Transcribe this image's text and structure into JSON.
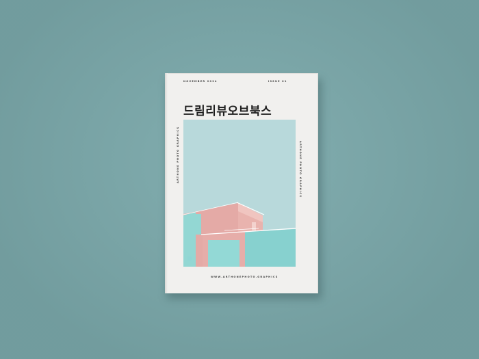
{
  "cover": {
    "date": "NOVEMBER 2024",
    "issue": "ISSUE 01",
    "title": "드림리뷰오브북스",
    "side_text_left": "ARTHONE PHOTO GRAPHICS",
    "side_text_right": "ARTHONE PHOTO GRAPHICS",
    "website": "WWW.ARTHONEPHOTO.GRAPHICS"
  },
  "colors": {
    "background": "#7ba9ab",
    "paper": "#f1f0ee",
    "sky": "#b7d8da",
    "pink_wall": "#e7aeaa",
    "mint_wall": "#8fd6d4"
  }
}
